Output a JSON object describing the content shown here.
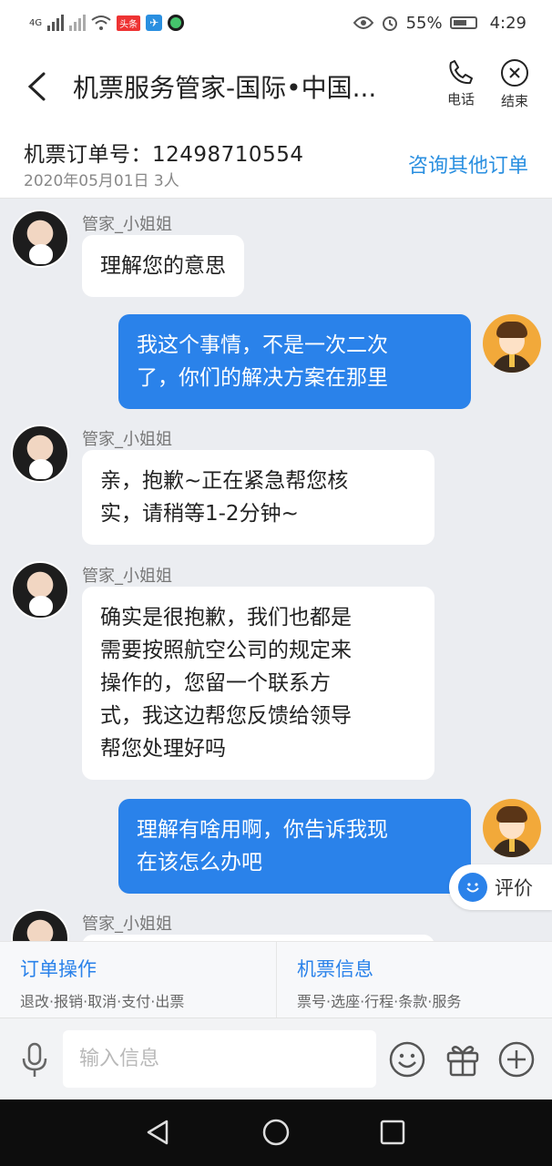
{
  "status_bar": {
    "network": "4G",
    "app_badge": "头条",
    "battery": "55%",
    "time": "4:29"
  },
  "header": {
    "title": "机票服务管家-国际•中国...",
    "call_label": "电话",
    "end_label": "结束"
  },
  "order": {
    "number": "机票订单号：12498710554",
    "date": "2020年05月01日 3人",
    "other_orders": "咨询其他订单"
  },
  "chat": {
    "agent_name": "管家_小姐姐",
    "messages": [
      {
        "from": "agent",
        "name": "管家_小姐姐",
        "lines": [
          "理解您的意思"
        ]
      },
      {
        "from": "user",
        "lines": [
          "我这个事情，不是一次二次",
          "了，你们的解决方案在那里"
        ]
      },
      {
        "from": "agent",
        "name": "管家_小姐姐",
        "lines": [
          "亲，抱歉~正在紧急帮您核",
          "实，请稍等1-2分钟~"
        ]
      },
      {
        "from": "agent",
        "name": "管家_小姐姐",
        "lines": [
          "确实是很抱歉，我们也都是",
          "需要按照航空公司的规定来",
          "操作的，您留一个联系方",
          "式，我这边帮您反馈给领导",
          "帮您处理好吗"
        ]
      },
      {
        "from": "user",
        "lines": [
          "理解有啥用啊，你告诉我现",
          "在该怎么办吧"
        ]
      },
      {
        "from": "agent",
        "name": "管家_小姐姐",
        "lines": []
      }
    ],
    "rate_label": "评价"
  },
  "actions": [
    {
      "title": "订单操作",
      "sub": "退改·报销·取消·支付·出票"
    },
    {
      "title": "机票信息",
      "sub": "票号·选座·行程·条款·服务"
    }
  ],
  "input": {
    "placeholder": "输入信息"
  },
  "colors": {
    "accent": "#2a82ea",
    "link": "#2a8fe0",
    "chat_bg": "#ebedf1"
  }
}
